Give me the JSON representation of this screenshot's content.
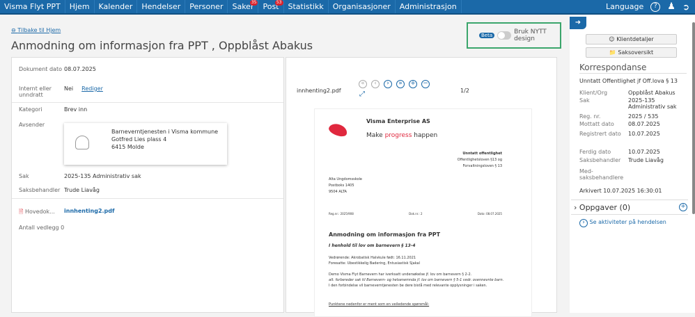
{
  "nav": {
    "items": [
      {
        "label": "Visma Flyt PPT"
      },
      {
        "label": "Hjem"
      },
      {
        "label": "Kalender"
      },
      {
        "label": "Hendelser"
      },
      {
        "label": "Personer"
      },
      {
        "label": "Saker",
        "badge": "35"
      },
      {
        "label": "Post",
        "badge": "53"
      },
      {
        "label": "Statistikk"
      },
      {
        "label": "Organisasjoner"
      },
      {
        "label": "Administrasjon"
      }
    ],
    "language": "Language"
  },
  "back_link": "Tilbake til Hjem",
  "title": "Anmodning om informasjon fra PPT , Oppblåst Abakus",
  "beta": {
    "badge": "Beta",
    "label": "Bruk NYTT design"
  },
  "details": {
    "dokument_dato_l": "Dokument dato",
    "dokument_dato": "08.07.2025",
    "internt_l": "Internt eller unndratt",
    "internt": "Nei",
    "rediger": "Rediger",
    "kategori_l": "Kategori",
    "kategori": "Brev inn",
    "avsender_l": "Avsender",
    "avsender": [
      "Barneverntjenesten i Visma kommune",
      "Gotfred Lies plass 4",
      "6415 Molde"
    ],
    "sak_l": "Sak",
    "sak": "2025-135 Administrativ sak",
    "saksbehandler_l": "Saksbehandler",
    "saksbehandler": "Trude Liavåg",
    "hoved_l": "Hovedok...",
    "hoved": "innhenting2.pdf",
    "vedlegg": "Antall vedlegg 0"
  },
  "pdf": {
    "filename": "innhenting2.pdf",
    "page": "1/2",
    "company": "Visma Enterprise AS",
    "slogan_a": "Make ",
    "slogan_b": "progress",
    "slogan_c": " happen",
    "unntatt": "Unntatt offentlighet",
    "lov1": "Offentlighetsloven §13 og",
    "lov2": "Forvaltningsloven § 13",
    "addr": [
      "Alta Ungdomsskole",
      "Postboks 1405",
      "9504 ALTA"
    ],
    "regnr": "Reg.nr.: 2025/908",
    "doknr": "Dok.nr.: 2",
    "dato": "Dato: 08.07.2025",
    "heading": "Anmodning om informasjon fra PPT",
    "sub": "I henhold til lov om barnevern § 13-4",
    "vedr": "Vedrørende: Akrobatisk Halvkule  født:  16.11.2021",
    "foresatte": "Foresatte: Ubestikkelig Badering, Entusiastisk Sjakal",
    "p1": "Demo Visma Flyt Barnevern har iverksatt undersøkelse jf. lov om barnevern § 2-2.",
    "p2": "alt. forbereder sak til Barnevern- og helsenemnda jf. lov om barnevern § 5-1 vedr. ovennevnte barn.",
    "p3": "I den forbindelse vil barneverntjenesten be dere bistå med relevante opplysninger i saken.",
    "punkt": "Punktene nedenfor er ment som en veiledende spørsmål:"
  },
  "side": {
    "klient_btn": "Klientdetaljer",
    "sak_btn": "Saksoversikt",
    "heading": "Korrespondanse",
    "unntatt": "Unntatt Offentlighet jf Off.lova § 13",
    "rows": [
      {
        "l": "Klient/Org",
        "v": "Oppblåst Abakus"
      },
      {
        "l": "Sak",
        "v": "2025-135 Administrativ sak"
      },
      {
        "l": "Reg. nr.",
        "v": "2025 / 535"
      },
      {
        "l": "Mottatt dato",
        "v": "08.07.2025"
      },
      {
        "l": "Registrert dato",
        "v": "10.07.2025"
      },
      {
        "l": "Ferdig dato",
        "v": "10.07.2025"
      },
      {
        "l": "Saksbehandler",
        "v": "Trude Liavåg"
      },
      {
        "l": "Med-saksbehandlere",
        "v": ""
      }
    ],
    "arkivert": "Arkivert 10.07.2025 16:30:01",
    "oppgaver": "Oppgaver (0)",
    "aktiviteter": "Se aktiviteter på hendelsen"
  }
}
